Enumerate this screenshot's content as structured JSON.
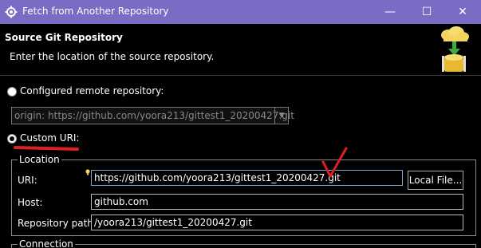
{
  "window": {
    "title": "Fetch from Another Repository",
    "minimize_glyph": "—",
    "maximize_glyph": "☐",
    "close_glyph": "✕"
  },
  "header": {
    "title": "Source Git Repository",
    "subtitle": "Enter the location of the source repository."
  },
  "options": {
    "configured_label": "Configured remote repository:",
    "configured_value": "origin: https://github.com/yoora213/gittest1_20200427.git",
    "custom_label": "Custom URI:"
  },
  "location": {
    "legend": "Location",
    "uri_label": "URI:",
    "uri_value": "https://github.com/yoora213/gittest1_20200427.git",
    "host_label": "Host:",
    "host_value": "github.com",
    "path_label": "Repository path:",
    "path_value": "/yoora213/gittest1_20200427.git",
    "local_file_button": "Local File..."
  },
  "connection": {
    "legend": "Connection"
  },
  "colors": {
    "titlebar": "#7b6bc4",
    "annotation": "#e02020"
  }
}
